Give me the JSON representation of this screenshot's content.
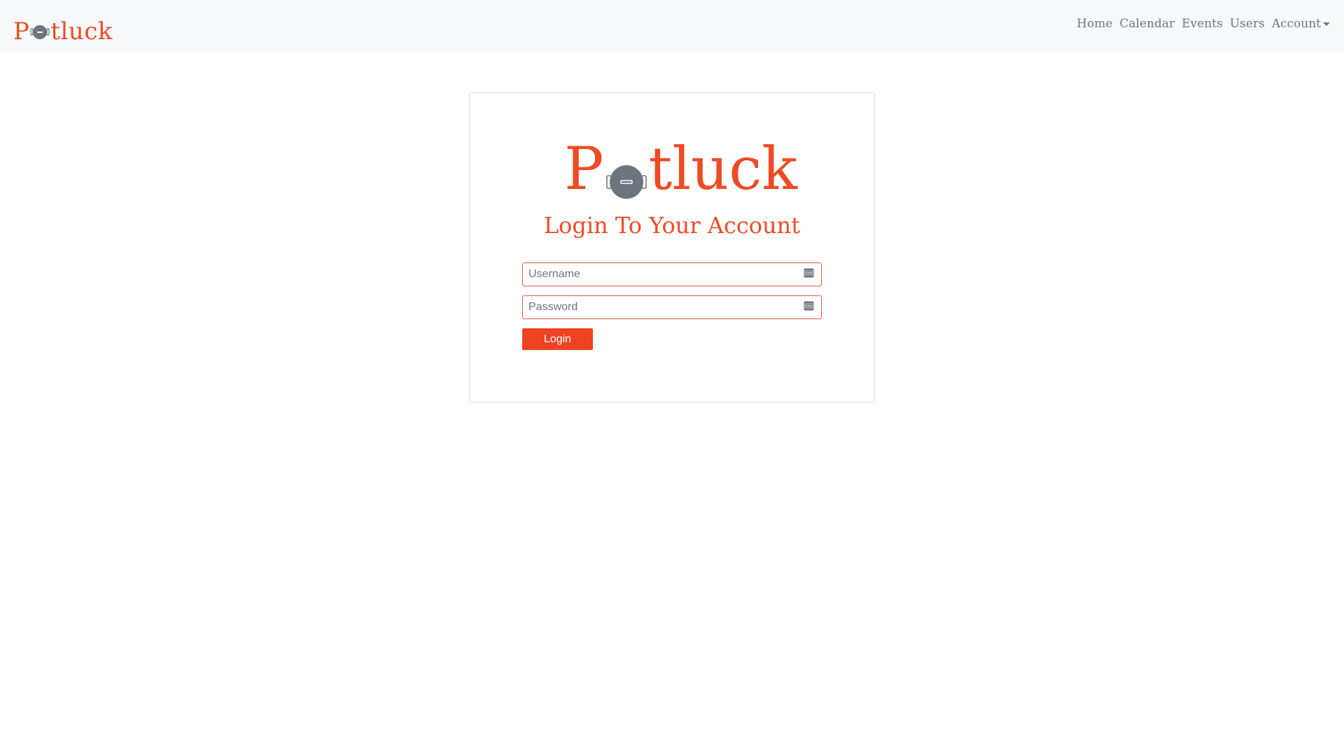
{
  "brand": {
    "name_prefix": "P",
    "name_suffix": "tluck",
    "logo_icon": "cooking-pot-icon",
    "accent_color": "#ee4b25"
  },
  "nav": {
    "items": [
      {
        "label": "Home"
      },
      {
        "label": "Calendar"
      },
      {
        "label": "Events"
      },
      {
        "label": "Users"
      },
      {
        "label": "Account"
      }
    ]
  },
  "login": {
    "title": "Login To Your Account",
    "username_placeholder": "Username",
    "password_placeholder": "Password",
    "button_label": "Login",
    "field_icon": "password-manager-key-icon"
  }
}
